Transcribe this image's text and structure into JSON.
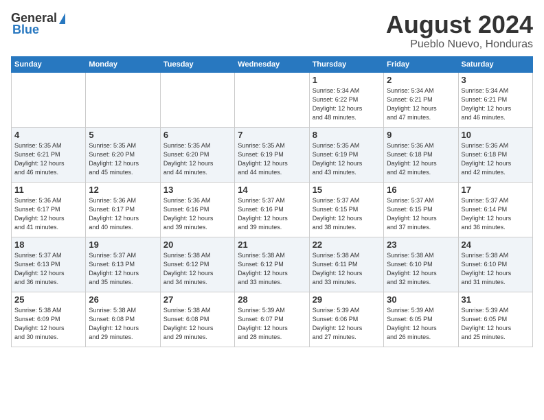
{
  "logo": {
    "general": "General",
    "blue": "Blue"
  },
  "header": {
    "month": "August 2024",
    "location": "Pueblo Nuevo, Honduras"
  },
  "days_of_week": [
    "Sunday",
    "Monday",
    "Tuesday",
    "Wednesday",
    "Thursday",
    "Friday",
    "Saturday"
  ],
  "weeks": [
    [
      {
        "day": "",
        "info": ""
      },
      {
        "day": "",
        "info": ""
      },
      {
        "day": "",
        "info": ""
      },
      {
        "day": "",
        "info": ""
      },
      {
        "day": "1",
        "info": "Sunrise: 5:34 AM\nSunset: 6:22 PM\nDaylight: 12 hours\nand 48 minutes."
      },
      {
        "day": "2",
        "info": "Sunrise: 5:34 AM\nSunset: 6:21 PM\nDaylight: 12 hours\nand 47 minutes."
      },
      {
        "day": "3",
        "info": "Sunrise: 5:34 AM\nSunset: 6:21 PM\nDaylight: 12 hours\nand 46 minutes."
      }
    ],
    [
      {
        "day": "4",
        "info": "Sunrise: 5:35 AM\nSunset: 6:21 PM\nDaylight: 12 hours\nand 46 minutes."
      },
      {
        "day": "5",
        "info": "Sunrise: 5:35 AM\nSunset: 6:20 PM\nDaylight: 12 hours\nand 45 minutes."
      },
      {
        "day": "6",
        "info": "Sunrise: 5:35 AM\nSunset: 6:20 PM\nDaylight: 12 hours\nand 44 minutes."
      },
      {
        "day": "7",
        "info": "Sunrise: 5:35 AM\nSunset: 6:19 PM\nDaylight: 12 hours\nand 44 minutes."
      },
      {
        "day": "8",
        "info": "Sunrise: 5:35 AM\nSunset: 6:19 PM\nDaylight: 12 hours\nand 43 minutes."
      },
      {
        "day": "9",
        "info": "Sunrise: 5:36 AM\nSunset: 6:18 PM\nDaylight: 12 hours\nand 42 minutes."
      },
      {
        "day": "10",
        "info": "Sunrise: 5:36 AM\nSunset: 6:18 PM\nDaylight: 12 hours\nand 42 minutes."
      }
    ],
    [
      {
        "day": "11",
        "info": "Sunrise: 5:36 AM\nSunset: 6:17 PM\nDaylight: 12 hours\nand 41 minutes."
      },
      {
        "day": "12",
        "info": "Sunrise: 5:36 AM\nSunset: 6:17 PM\nDaylight: 12 hours\nand 40 minutes."
      },
      {
        "day": "13",
        "info": "Sunrise: 5:36 AM\nSunset: 6:16 PM\nDaylight: 12 hours\nand 39 minutes."
      },
      {
        "day": "14",
        "info": "Sunrise: 5:37 AM\nSunset: 6:16 PM\nDaylight: 12 hours\nand 39 minutes."
      },
      {
        "day": "15",
        "info": "Sunrise: 5:37 AM\nSunset: 6:15 PM\nDaylight: 12 hours\nand 38 minutes."
      },
      {
        "day": "16",
        "info": "Sunrise: 5:37 AM\nSunset: 6:15 PM\nDaylight: 12 hours\nand 37 minutes."
      },
      {
        "day": "17",
        "info": "Sunrise: 5:37 AM\nSunset: 6:14 PM\nDaylight: 12 hours\nand 36 minutes."
      }
    ],
    [
      {
        "day": "18",
        "info": "Sunrise: 5:37 AM\nSunset: 6:13 PM\nDaylight: 12 hours\nand 36 minutes."
      },
      {
        "day": "19",
        "info": "Sunrise: 5:37 AM\nSunset: 6:13 PM\nDaylight: 12 hours\nand 35 minutes."
      },
      {
        "day": "20",
        "info": "Sunrise: 5:38 AM\nSunset: 6:12 PM\nDaylight: 12 hours\nand 34 minutes."
      },
      {
        "day": "21",
        "info": "Sunrise: 5:38 AM\nSunset: 6:12 PM\nDaylight: 12 hours\nand 33 minutes."
      },
      {
        "day": "22",
        "info": "Sunrise: 5:38 AM\nSunset: 6:11 PM\nDaylight: 12 hours\nand 33 minutes."
      },
      {
        "day": "23",
        "info": "Sunrise: 5:38 AM\nSunset: 6:10 PM\nDaylight: 12 hours\nand 32 minutes."
      },
      {
        "day": "24",
        "info": "Sunrise: 5:38 AM\nSunset: 6:10 PM\nDaylight: 12 hours\nand 31 minutes."
      }
    ],
    [
      {
        "day": "25",
        "info": "Sunrise: 5:38 AM\nSunset: 6:09 PM\nDaylight: 12 hours\nand 30 minutes."
      },
      {
        "day": "26",
        "info": "Sunrise: 5:38 AM\nSunset: 6:08 PM\nDaylight: 12 hours\nand 29 minutes."
      },
      {
        "day": "27",
        "info": "Sunrise: 5:38 AM\nSunset: 6:08 PM\nDaylight: 12 hours\nand 29 minutes."
      },
      {
        "day": "28",
        "info": "Sunrise: 5:39 AM\nSunset: 6:07 PM\nDaylight: 12 hours\nand 28 minutes."
      },
      {
        "day": "29",
        "info": "Sunrise: 5:39 AM\nSunset: 6:06 PM\nDaylight: 12 hours\nand 27 minutes."
      },
      {
        "day": "30",
        "info": "Sunrise: 5:39 AM\nSunset: 6:05 PM\nDaylight: 12 hours\nand 26 minutes."
      },
      {
        "day": "31",
        "info": "Sunrise: 5:39 AM\nSunset: 6:05 PM\nDaylight: 12 hours\nand 25 minutes."
      }
    ]
  ]
}
